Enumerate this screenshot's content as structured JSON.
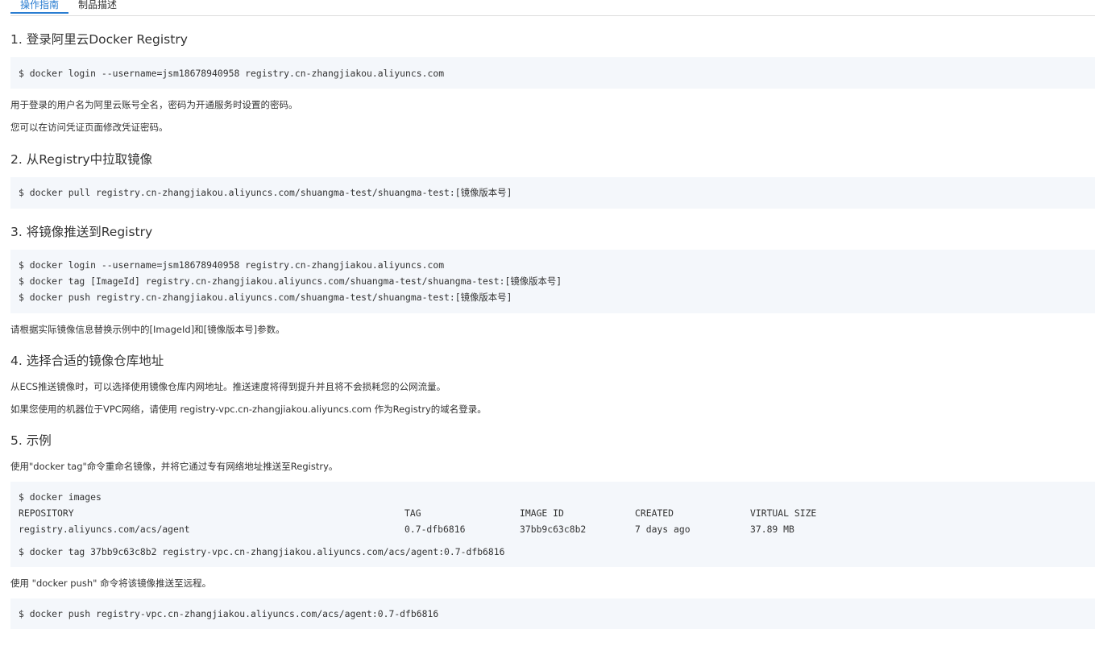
{
  "tabs": {
    "guide": "操作指南",
    "description": "制品描述"
  },
  "step1": {
    "heading": "1. 登录阿里云Docker Registry",
    "code": [
      "$ docker login --username=jsm18678940958 registry.cn-zhangjiakou.aliyuncs.com"
    ],
    "notes": [
      "用于登录的用户名为阿里云账号全名，密码为开通服务时设置的密码。",
      "您可以在访问凭证页面修改凭证密码。"
    ]
  },
  "step2": {
    "heading": "2. 从Registry中拉取镜像",
    "code": [
      "$ docker pull registry.cn-zhangjiakou.aliyuncs.com/shuangma-test/shuangma-test:[镜像版本号]"
    ]
  },
  "step3": {
    "heading": "3. 将镜像推送到Registry",
    "code": [
      "$ docker login --username=jsm18678940958 registry.cn-zhangjiakou.aliyuncs.com",
      "$ docker tag [ImageId] registry.cn-zhangjiakou.aliyuncs.com/shuangma-test/shuangma-test:[镜像版本号]",
      "$ docker push registry.cn-zhangjiakou.aliyuncs.com/shuangma-test/shuangma-test:[镜像版本号]"
    ],
    "note": "请根据实际镜像信息替换示例中的[ImageId]和[镜像版本号]参数。"
  },
  "step4": {
    "heading": "4. 选择合适的镜像仓库地址",
    "notes": [
      "从ECS推送镜像时，可以选择使用镜像仓库内网地址。推送速度将得到提升并且将不会损耗您的公网流量。",
      "如果您使用的机器位于VPC网络，请使用 registry-vpc.cn-zhangjiakou.aliyuncs.com 作为Registry的域名登录。"
    ]
  },
  "step5": {
    "heading": "5. 示例",
    "intro": "使用\"docker tag\"命令重命名镜像，并将它通过专有网络地址推送至Registry。",
    "images_cmd": "$ docker images",
    "table": {
      "headers": [
        "REPOSITORY",
        "TAG",
        "IMAGE ID",
        "CREATED",
        "VIRTUAL SIZE"
      ],
      "row": [
        "registry.aliyuncs.com/acs/agent",
        "0.7-dfb6816",
        "37bb9c63c8b2",
        "7 days ago",
        "37.89 MB"
      ]
    },
    "tag_cmd": "$ docker tag 37bb9c63c8b2 registry-vpc.cn-zhangjiakou.aliyuncs.com/acs/agent:0.7-dfb6816",
    "push_intro": "使用 \"docker push\" 命令将该镜像推送至远程。",
    "push_cmd": "$ docker push registry-vpc.cn-zhangjiakou.aliyuncs.com/acs/agent:0.7-dfb6816"
  }
}
